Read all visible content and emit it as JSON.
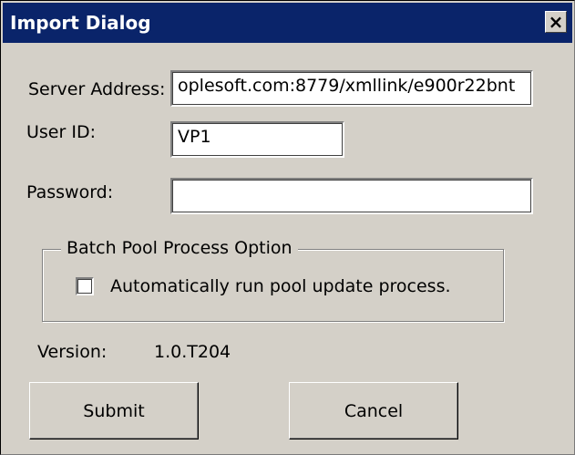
{
  "dialog": {
    "title": "Import Dialog",
    "close_label": "×"
  },
  "form": {
    "server_address": {
      "label": "Server Address:",
      "value": "oplesoft.com:8779/xmllink/e900r22bnt"
    },
    "user_id": {
      "label": "User ID:",
      "value": "VP1"
    },
    "password": {
      "label": "Password:",
      "value": ""
    }
  },
  "batch_pool": {
    "legend": "Batch Pool Process Option",
    "checkbox_label": "Automatically run pool update process.",
    "checked": false
  },
  "version": {
    "label": "Version:",
    "value": "1.0.T204"
  },
  "buttons": {
    "submit": "Submit",
    "cancel": "Cancel"
  }
}
